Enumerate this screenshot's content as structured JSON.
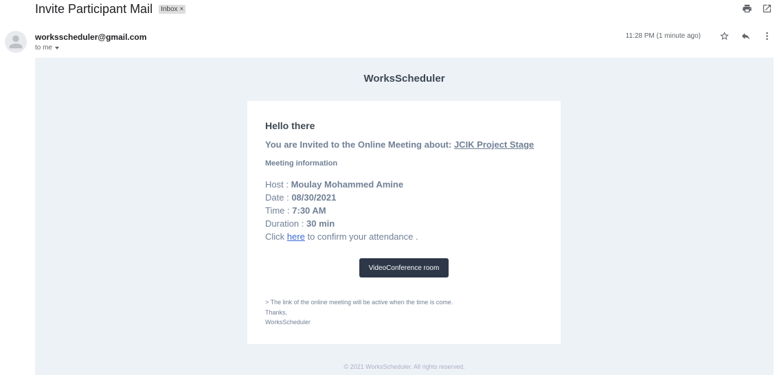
{
  "header": {
    "subject": "Invite Participant Mail",
    "label": "Inbox",
    "label_close": "×"
  },
  "sender": {
    "email": "worksscheduler@gmail.com",
    "recipient": "to me",
    "timestamp": "11:28 PM (1 minute ago)"
  },
  "icons": {
    "print": "print-icon",
    "open_new_window": "open-in-new-window-icon",
    "star": "star-icon",
    "reply": "reply-icon",
    "more": "more-vertical-icon",
    "avatar": "person-icon"
  },
  "email": {
    "brand": "WorksScheduler",
    "greeting": "Hello there",
    "invite_prefix": "You are Invited to the Online Meeting about:",
    "meeting_name": "JCIK Project Stage",
    "section_title": "Meeting information",
    "host_label": "Host :",
    "host_value": "Moulay Mohammed Amine",
    "date_label": "Date :",
    "date_value": "08/30/2021",
    "time_label": "Time :",
    "time_value": "7:30 AM",
    "duration_label": "Duration :",
    "duration_value": "30 min",
    "click_prefix": "Click",
    "click_link": "here",
    "click_suffix": "to confirm your attendance .",
    "button_label": "VideoConference room",
    "note": "> The link of the online meeting will be active when the time is come.",
    "thanks": "Thanks,",
    "signature": "WorksScheduler",
    "copyright": "© 2021 WorksScheduler. All rights reserved."
  },
  "colors": {
    "body_background": "#edf2f7",
    "button_background": "#2d3748",
    "link": "#3869d4",
    "muted_text": "#718096",
    "heading_text": "#3d4852"
  }
}
